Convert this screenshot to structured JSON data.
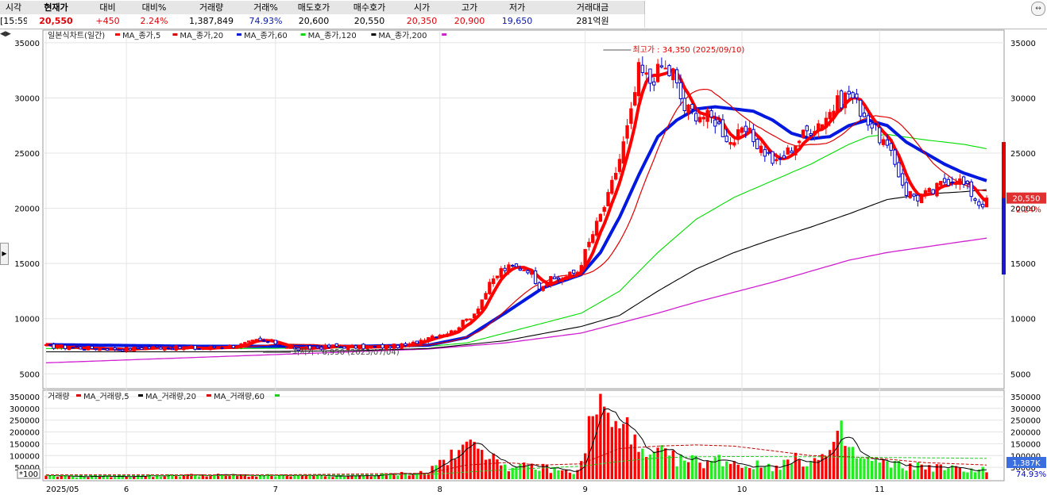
{
  "quote_bar": {
    "headers": [
      "시각",
      "현재가",
      "대비",
      "대비%",
      "거래량",
      "거래%",
      "매도호가",
      "매수호가",
      "시가",
      "고가",
      "저가",
      "거래대금"
    ],
    "values": [
      "[15:59]",
      "20,550",
      "+450",
      "2.24%",
      "1,387,849",
      "74.93%",
      "20,600",
      "20,550",
      "20,350",
      "20,900",
      "19,650",
      "281억원"
    ]
  },
  "colors": {
    "up": "#ff0000",
    "down": "#0000c8",
    "ma5": "#ff0000",
    "ma20": "#e00000",
    "ma60": "#0018e0",
    "ma120": "#00dd00",
    "ma200": "#000000",
    "ma_extra": "#d020d0",
    "vol_up": "#ff0000",
    "vol_down": "#22ee22"
  },
  "icons": {
    "nav": "double-arrow-icon",
    "toggle": "chevron-right-icon",
    "expander": "expand-icon"
  },
  "chart_data": [
    {
      "type": "candlestick",
      "title": "일본식차트(일간)",
      "legend": [
        "MA_종가,5",
        "MA_종가,20",
        "MA_종가,60",
        "MA_종가,120",
        "MA_종가,200"
      ],
      "x_tick_labels": [
        {
          "label": "2025/05",
          "index": 0
        },
        {
          "label": "6",
          "index": 21
        },
        {
          "label": "7",
          "index": 60
        },
        {
          "label": "8",
          "index": 103
        },
        {
          "label": "9",
          "index": 141
        },
        {
          "label": "10",
          "index": 182
        },
        {
          "label": "11",
          "index": 218
        }
      ],
      "y_ticks": [
        5000,
        10000,
        15000,
        20000,
        25000,
        30000,
        35000
      ],
      "ylim": [
        3800,
        36000
      ],
      "annotations": [
        {
          "text": "최고가 : 34,350 (2025/09/10)",
          "index": 153,
          "price": 34350
        },
        {
          "text": "최저가 : 6,950 (2025/07/04)",
          "index": 64,
          "price": 6950
        }
      ],
      "last_price_label": "20,550",
      "last_change_label": "2.24%",
      "price_anchors": [
        [
          0,
          7500
        ],
        [
          10,
          7350
        ],
        [
          20,
          7250
        ],
        [
          30,
          7400
        ],
        [
          40,
          7300
        ],
        [
          50,
          7550
        ],
        [
          55,
          8000
        ],
        [
          60,
          7800
        ],
        [
          65,
          7200
        ],
        [
          75,
          7500
        ],
        [
          85,
          7400
        ],
        [
          95,
          7600
        ],
        [
          100,
          8400
        ],
        [
          106,
          8800
        ],
        [
          112,
          10500
        ],
        [
          116,
          13000
        ],
        [
          119,
          14400
        ],
        [
          122,
          14700
        ],
        [
          126,
          14500
        ],
        [
          129,
          13000
        ],
        [
          132,
          13500
        ],
        [
          136,
          13800
        ],
        [
          139,
          14300
        ],
        [
          141,
          16000
        ],
        [
          144,
          18500
        ],
        [
          147,
          21000
        ],
        [
          150,
          24500
        ],
        [
          153,
          28500
        ],
        [
          155,
          32500
        ],
        [
          158,
          31500
        ],
        [
          161,
          32800
        ],
        [
          164,
          32000
        ],
        [
          167,
          29000
        ],
        [
          171,
          28500
        ],
        [
          175,
          28000
        ],
        [
          179,
          26000
        ],
        [
          183,
          27000
        ],
        [
          187,
          25500
        ],
        [
          191,
          24000
        ],
        [
          195,
          25500
        ],
        [
          199,
          27000
        ],
        [
          203,
          28000
        ],
        [
          207,
          29500
        ],
        [
          210,
          30500
        ],
        [
          213,
          29000
        ],
        [
          216,
          27500
        ],
        [
          219,
          26000
        ],
        [
          222,
          24000
        ],
        [
          225,
          21500
        ],
        [
          228,
          21000
        ],
        [
          232,
          21500
        ],
        [
          235,
          22500
        ],
        [
          238,
          22800
        ],
        [
          241,
          21800
        ],
        [
          244,
          20500
        ],
        [
          246,
          20550
        ]
      ],
      "ma60_anchors": [
        [
          0,
          7650
        ],
        [
          40,
          7500
        ],
        [
          80,
          7500
        ],
        [
          100,
          7600
        ],
        [
          110,
          8300
        ],
        [
          120,
          10500
        ],
        [
          130,
          12800
        ],
        [
          140,
          14000
        ],
        [
          145,
          16000
        ],
        [
          150,
          19200
        ],
        [
          155,
          23000
        ],
        [
          160,
          26500
        ],
        [
          165,
          28000
        ],
        [
          170,
          29000
        ],
        [
          175,
          29200
        ],
        [
          180,
          29000
        ],
        [
          185,
          28800
        ],
        [
          190,
          28000
        ],
        [
          195,
          26800
        ],
        [
          200,
          26300
        ],
        [
          205,
          26500
        ],
        [
          210,
          27500
        ],
        [
          215,
          28000
        ],
        [
          220,
          27500
        ],
        [
          225,
          26000
        ],
        [
          230,
          25000
        ],
        [
          235,
          24000
        ],
        [
          240,
          23200
        ],
        [
          246,
          22500
        ]
      ],
      "ma120_anchors": [
        [
          0,
          7300
        ],
        [
          50,
          7300
        ],
        [
          80,
          7350
        ],
        [
          100,
          7500
        ],
        [
          110,
          7800
        ],
        [
          120,
          8700
        ],
        [
          130,
          9600
        ],
        [
          140,
          10500
        ],
        [
          150,
          12500
        ],
        [
          160,
          16000
        ],
        [
          170,
          19000
        ],
        [
          180,
          21000
        ],
        [
          190,
          22500
        ],
        [
          200,
          24000
        ],
        [
          210,
          25800
        ],
        [
          215,
          26500
        ],
        [
          220,
          26700
        ],
        [
          230,
          26200
        ],
        [
          240,
          25800
        ],
        [
          246,
          25400
        ]
      ],
      "ma200_anchors": [
        [
          0,
          7000
        ],
        [
          50,
          7000
        ],
        [
          80,
          7100
        ],
        [
          100,
          7300
        ],
        [
          120,
          8000
        ],
        [
          140,
          9300
        ],
        [
          150,
          10300
        ],
        [
          160,
          12500
        ],
        [
          170,
          14500
        ],
        [
          180,
          16000
        ],
        [
          190,
          17200
        ],
        [
          200,
          18300
        ],
        [
          210,
          19500
        ],
        [
          220,
          20800
        ],
        [
          230,
          21300
        ],
        [
          240,
          21500
        ],
        [
          246,
          21700
        ]
      ],
      "ma_extra_anchors": [
        [
          0,
          6000
        ],
        [
          40,
          6500
        ],
        [
          80,
          7000
        ],
        [
          100,
          7250
        ],
        [
          120,
          7800
        ],
        [
          140,
          8700
        ],
        [
          150,
          9600
        ],
        [
          160,
          10500
        ],
        [
          170,
          11500
        ],
        [
          180,
          12400
        ],
        [
          190,
          13300
        ],
        [
          200,
          14300
        ],
        [
          210,
          15300
        ],
        [
          220,
          16000
        ],
        [
          230,
          16500
        ],
        [
          240,
          17000
        ],
        [
          246,
          17300
        ]
      ]
    },
    {
      "type": "bar",
      "title": "거래량",
      "legend": [
        "MA_거래량,5",
        "MA_거래량,20",
        "MA_거래량,60"
      ],
      "y_ticks": [
        50000,
        100000,
        150000,
        200000,
        250000,
        300000,
        350000
      ],
      "y_tick_labels": [
        "50000",
        "100000",
        "150000",
        "200000",
        "250000",
        "300000",
        "350000"
      ],
      "ylim": [
        0,
        370000
      ],
      "last_volume_label": "1,387K",
      "last_volume_pct_label": "74.93%",
      "scale_label": "*100",
      "volume_anchors": [
        [
          0,
          12000
        ],
        [
          20,
          12000
        ],
        [
          40,
          18000
        ],
        [
          60,
          15000
        ],
        [
          80,
          12000
        ],
        [
          95,
          25000
        ],
        [
          100,
          30000
        ],
        [
          103,
          75000
        ],
        [
          107,
          95000
        ],
        [
          110,
          135000
        ],
        [
          113,
          210000
        ],
        [
          116,
          75000
        ],
        [
          119,
          85000
        ],
        [
          122,
          40000
        ],
        [
          126,
          55000
        ],
        [
          130,
          48000
        ],
        [
          134,
          38000
        ],
        [
          138,
          30000
        ],
        [
          140,
          60000
        ],
        [
          142,
          210000
        ],
        [
          144,
          330000
        ],
        [
          146,
          275000
        ],
        [
          148,
          230000
        ],
        [
          150,
          180000
        ],
        [
          152,
          340000
        ],
        [
          154,
          140000
        ],
        [
          156,
          100000
        ],
        [
          158,
          80000
        ],
        [
          160,
          120000
        ],
        [
          162,
          95000
        ],
        [
          166,
          80000
        ],
        [
          172,
          75000
        ],
        [
          178,
          85000
        ],
        [
          182,
          60000
        ],
        [
          190,
          55000
        ],
        [
          196,
          80000
        ],
        [
          202,
          80000
        ],
        [
          206,
          120000
        ],
        [
          208,
          185000
        ],
        [
          212,
          90000
        ],
        [
          218,
          70000
        ],
        [
          224,
          55000
        ],
        [
          230,
          55000
        ],
        [
          236,
          45000
        ],
        [
          246,
          40000
        ]
      ],
      "volume_ma20_anchors": [
        [
          0,
          18000
        ],
        [
          60,
          18000
        ],
        [
          100,
          25000
        ],
        [
          110,
          60000
        ],
        [
          120,
          70000
        ],
        [
          130,
          60000
        ],
        [
          140,
          65000
        ],
        [
          150,
          130000
        ],
        [
          160,
          140000
        ],
        [
          170,
          145000
        ],
        [
          180,
          140000
        ],
        [
          190,
          120000
        ],
        [
          200,
          100000
        ],
        [
          210,
          95000
        ],
        [
          220,
          85000
        ],
        [
          230,
          70000
        ],
        [
          246,
          60000
        ]
      ],
      "volume_ma60_anchors": [
        [
          0,
          15000
        ],
        [
          60,
          15000
        ],
        [
          100,
          20000
        ],
        [
          120,
          40000
        ],
        [
          140,
          55000
        ],
        [
          150,
          75000
        ],
        [
          160,
          90000
        ],
        [
          170,
          95000
        ],
        [
          180,
          96000
        ],
        [
          200,
          95000
        ],
        [
          220,
          92000
        ],
        [
          246,
          88000
        ]
      ]
    }
  ]
}
